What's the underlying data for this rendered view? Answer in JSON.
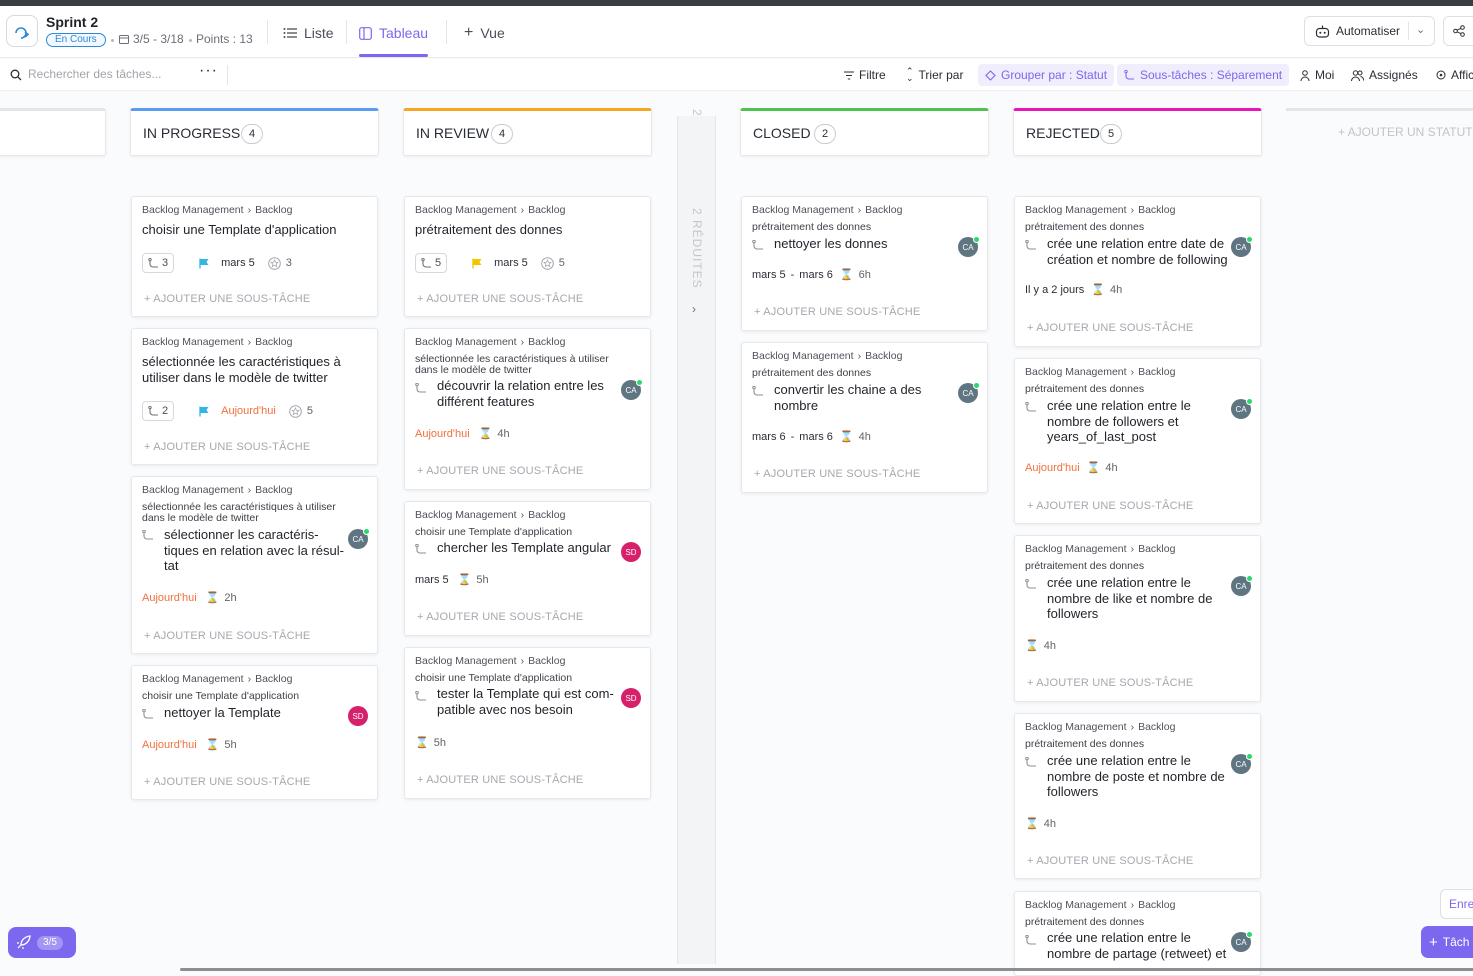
{
  "header": {
    "title": "Sprint 2",
    "status": "En Cours",
    "dates": "3/5 - 3/18",
    "points": "Points : 13",
    "views": [
      "Liste",
      "Tableau",
      "Vue"
    ],
    "automate": "Automatiser"
  },
  "toolbar": {
    "search_placeholder": "Rechercher des tâches...",
    "filter": "Filtre",
    "sort": "Trier par",
    "group": "Grouper par : Statut",
    "subtasks": "Sous-tâches : Séparement",
    "me": "Moi",
    "assignees": "Assignés",
    "show": "Affic"
  },
  "add_subtask": "+ AJOUTER UNE SOUS-TÂCHE",
  "crumb": {
    "space": "Backlog Management",
    "list": "Backlog"
  },
  "columns": [
    {
      "name": "IN PROGRESS",
      "count": "4",
      "color": "#5b9bf0"
    },
    {
      "name": "IN REVIEW",
      "count": "4",
      "color": "#f5a623"
    },
    {
      "name": "CLOSED",
      "count": "2",
      "color": "#4fc24f"
    },
    {
      "name": "REJECTED",
      "count": "5",
      "color": "#e816b8"
    }
  ],
  "collapsed": {
    "count": "2",
    "label": "2 RÉDUITES"
  },
  "add_status": "+ AJOUTER UN STATUT",
  "colors": {
    "accent": "#7b68ee",
    "today": "#f0703c",
    "avatar_ca": "#5f7682",
    "avatar_sd": "#d6206a"
  },
  "cards": {
    "c1": {
      "title": "choisir une Template d'application",
      "subs": "3",
      "date": "mars 5",
      "pts": "3"
    },
    "c2": {
      "title": "sélectionnée les caractéristiques à utiliser dans le modèle de twitter",
      "subs": "2",
      "date": "Aujourd'hui",
      "pts": "5"
    },
    "c3": {
      "parent": "sélectionnée les caractéristiques à utiliser dans le modèle de twitter",
      "title": "sélectionner les caractéris-tiques en relation avec la résul-tat",
      "date": "Aujourd'hui",
      "time": "2h",
      "avatar": "CA"
    },
    "c4": {
      "parent": "choisir une Template d'application",
      "title": "nettoyer la Template",
      "date": "Aujourd'hui",
      "time": "5h",
      "avatar": "SD"
    },
    "r1": {
      "title": "prétraitement des donnes",
      "subs": "5",
      "date": "mars 5",
      "pts": "5"
    },
    "r2": {
      "parent": "sélectionnée les caractéristiques à utiliser dans le modèle de twitter",
      "title": "découvrir la relation entre les différent features",
      "date": "Aujourd'hui",
      "time": "4h",
      "avatar": "CA"
    },
    "r3": {
      "parent": "choisir une Template d'application",
      "title": "chercher les Template angular",
      "date": "mars 5",
      "time": "5h",
      "avatar": "SD"
    },
    "r4": {
      "parent": "choisir une Template d'application",
      "title": "tester la Template qui est com-patible avec nos besoin",
      "time": "5h",
      "avatar": "SD"
    },
    "k1": {
      "parent": "prétraitement des donnes",
      "title": "nettoyer les donnes",
      "start": "mars 5",
      "end": "mars 6",
      "time": "6h",
      "avatar": "CA"
    },
    "k2": {
      "parent": "prétraitement des donnes",
      "title": "convertir les chaine a des nombre",
      "start": "mars 6",
      "end": "mars 6",
      "time": "4h",
      "avatar": "CA"
    },
    "j1": {
      "parent": "prétraitement des donnes",
      "title": "crée une relation entre date de création et nombre de following",
      "date": "Il y a 2 jours",
      "time": "4h",
      "avatar": "CA"
    },
    "j2": {
      "parent": "prétraitement des donnes",
      "title": "crée une relation entre le nombre de followers et years_of_last_post",
      "date": "Aujourd'hui",
      "time": "4h",
      "avatar": "CA"
    },
    "j3": {
      "parent": "prétraitement des donnes",
      "title": "crée une relation entre le nombre de like et nombre de followers",
      "time": "4h",
      "avatar": "CA"
    },
    "j4": {
      "parent": "prétraitement des donnes",
      "title": "crée une relation entre le nombre de poste et nombre de followers",
      "time": "4h",
      "avatar": "CA"
    },
    "j5": {
      "parent": "prétraitement des donnes",
      "title": "crée une relation entre le nombre de partage (retweet) et",
      "avatar": "CA"
    }
  },
  "bottom": {
    "launch": "3/5",
    "save": "Enre",
    "task": "Tâch"
  }
}
